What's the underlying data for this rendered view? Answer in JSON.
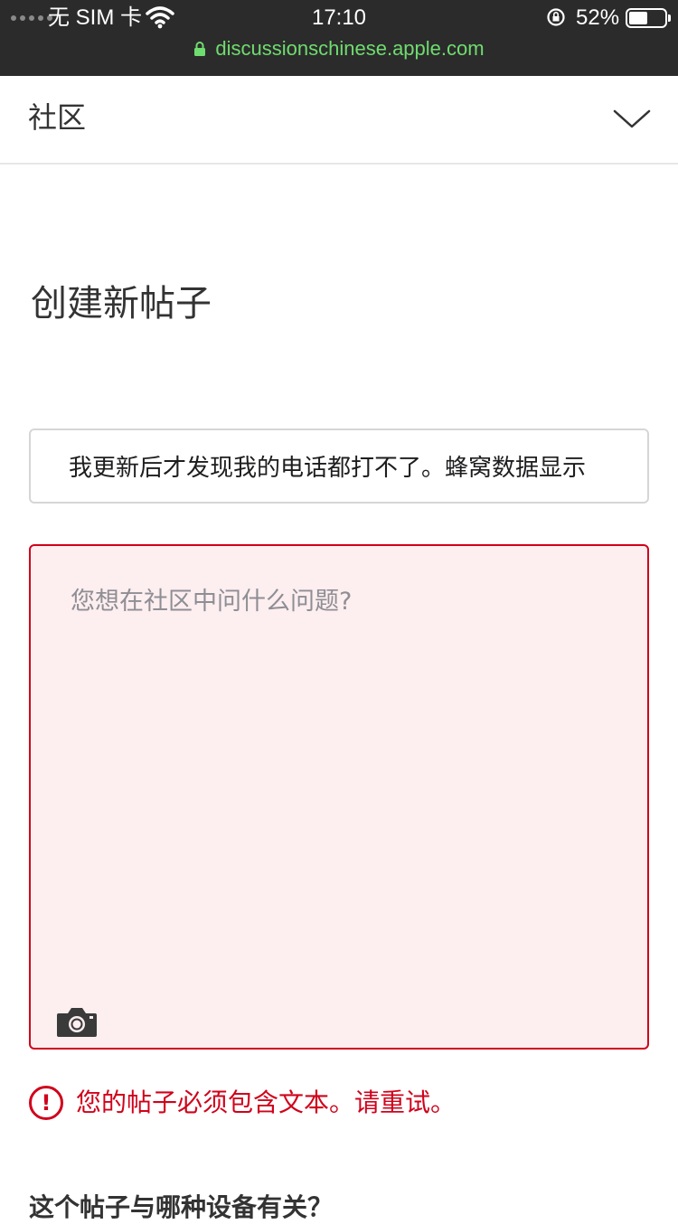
{
  "status_bar": {
    "carrier": "无 SIM 卡",
    "time": "17:10",
    "battery_percent": "52%",
    "battery_level": 0.52,
    "url": "discussionschinese.apple.com"
  },
  "site_header": {
    "title": "社区"
  },
  "main": {
    "page_title": "创建新帖子",
    "subject_value": "我更新后才发现我的电话都打不了。蜂窝数据显示",
    "body_placeholder": "您想在社区中问什么问题?",
    "error_message": "您的帖子必须包含文本。请重试。",
    "error_icon_glyph": "!",
    "cutoff_text": "这个帖子与哪种设备有关？"
  },
  "colors": {
    "status_bg": "#2b2b2b",
    "url_green": "#6fdc6f",
    "error_red": "#d0021b",
    "error_bg": "#fdeef0"
  }
}
